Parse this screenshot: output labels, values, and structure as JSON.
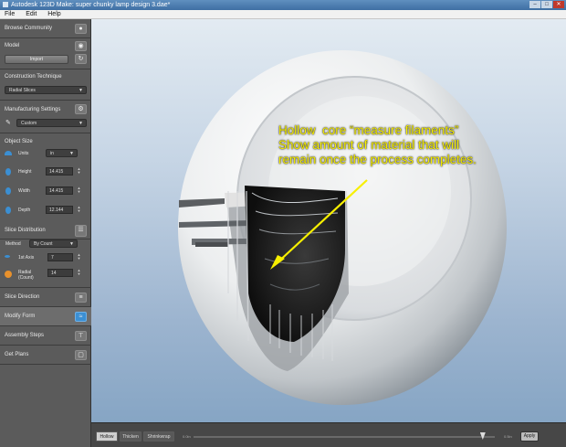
{
  "window": {
    "title": "Autodesk 123D Make: super chunky lamp design 3.dae*",
    "buttons": {
      "minimize": "–",
      "maximize": "□",
      "close": "✕"
    }
  },
  "menu": {
    "items": [
      "File",
      "Edit",
      "Help"
    ]
  },
  "sidebar": {
    "browse_community": {
      "label": "Browse Community",
      "icon": "people-icon"
    },
    "model": {
      "label": "Model",
      "icon": "eye-icon",
      "import_label": "Import",
      "refresh_icon": "refresh-icon"
    },
    "construction": {
      "label": "Construction Technique",
      "value": "Radial Slices"
    },
    "manufacturing": {
      "label": "Manufacturing Settings",
      "value": "Custom",
      "icon": "gear-icon"
    },
    "object_size": {
      "label": "Object Size",
      "units_label": "Units",
      "units_value": "in",
      "height_label": "Height",
      "height_value": "14.415",
      "width_label": "Width",
      "width_value": "14.415",
      "depth_label": "Depth",
      "depth_value": "12.144"
    },
    "slice_distribution": {
      "label": "Slice Distribution",
      "method_label": "Method",
      "method_value": "By Count",
      "axis_label": "1st Axis",
      "axis_value": "7",
      "radial_label": "Radial",
      "radial_sub": "(Count)",
      "radial_value": "14"
    },
    "slice_direction": {
      "label": "Slice Direction"
    },
    "modify_form": {
      "label": "Modify Form"
    },
    "assembly_steps": {
      "label": "Assembly Steps"
    },
    "get_plans": {
      "label": "Get Plans"
    }
  },
  "annotation": {
    "text": "Hollow  core “measure filaments”\nShow amount of material that will\nremain once the process completes."
  },
  "bottom": {
    "tabs": [
      "Hollow",
      "Thicken",
      "Shrinkwrap"
    ],
    "active_tab": 0,
    "slider_min": "0.0in",
    "slider_max": "0.5in",
    "slider_fraction": 0.96,
    "apply_label": "Apply"
  },
  "colors": {
    "accent": "#3b8fd3",
    "callout": "#f7ef00"
  }
}
